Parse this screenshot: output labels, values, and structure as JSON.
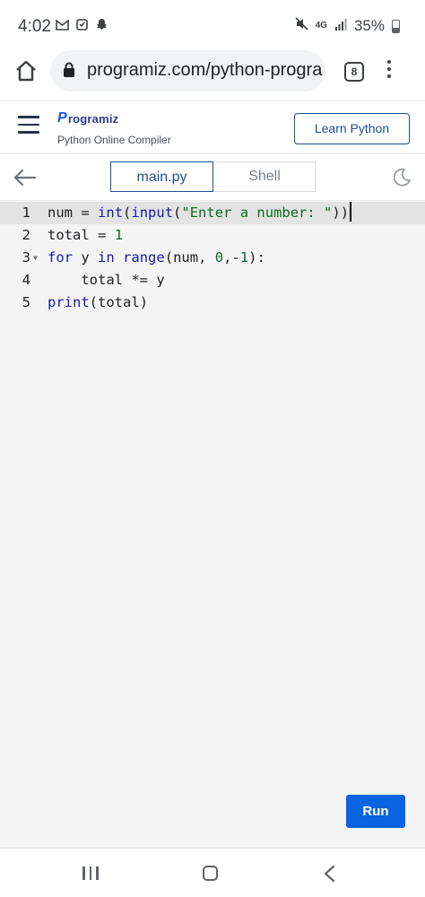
{
  "status_bar": {
    "time": "4:02",
    "network": "4G",
    "battery": "35%",
    "icons": [
      "gmail-icon",
      "app-icon",
      "snapchat-icon",
      "mute-icon",
      "network-icon",
      "signal-icon",
      "battery-icon"
    ]
  },
  "browser": {
    "url": "programiz.com/python-progra",
    "tab_count": "8"
  },
  "header": {
    "logo_initial": "P",
    "logo_text": "rogramiz",
    "subtitle": "Python Online Compiler",
    "learn_button": "Learn Python"
  },
  "toolbar": {
    "tabs": [
      {
        "label": "main.py",
        "active": true
      },
      {
        "label": "Shell",
        "active": false
      }
    ]
  },
  "editor": {
    "active_line": 1,
    "lines": [
      {
        "number": "1",
        "text": "num = int(input(\"Enter a number: \"))"
      },
      {
        "number": "2",
        "text": "total = 1"
      },
      {
        "number": "3",
        "text": "for y in range(num, 0,-1):"
      },
      {
        "number": "4",
        "text": "    total *= y"
      },
      {
        "number": "5",
        "text": "print(total)"
      }
    ]
  },
  "run_button": "Run",
  "colors": {
    "accent": "#0a63e0",
    "tab_active": "#1f4f8e",
    "keyword": "#1a1aa6",
    "number": "#0d6c32",
    "editor_bg": "#f4f4f4"
  }
}
